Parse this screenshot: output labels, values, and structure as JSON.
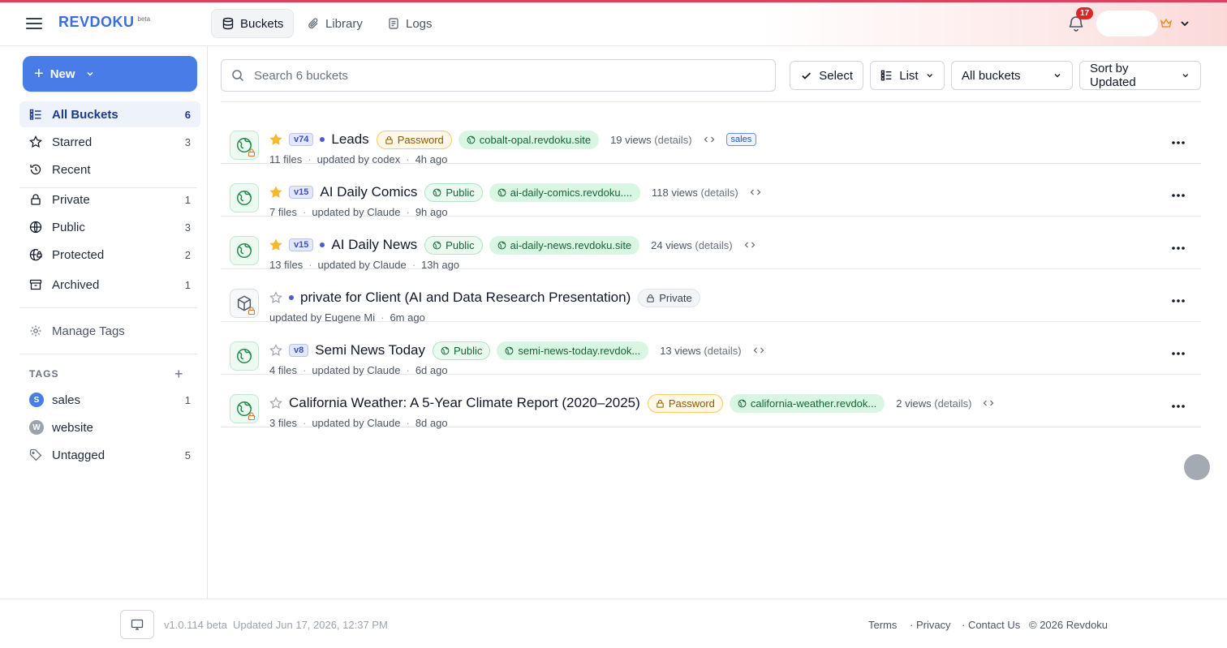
{
  "header": {
    "logo": "REVDOKU",
    "logo_badge": "beta",
    "tabs": [
      {
        "label": "Buckets",
        "icon": "database-icon",
        "active": true
      },
      {
        "label": "Library",
        "icon": "paperclip-icon"
      },
      {
        "label": "Logs",
        "icon": "logs-icon"
      }
    ],
    "notification_count": "17"
  },
  "sidebar": {
    "new_label": "New",
    "items": [
      {
        "label": "All Buckets",
        "count": "6"
      },
      {
        "label": "Starred",
        "count": "3"
      },
      {
        "label": "Recent"
      },
      {
        "label": "Private",
        "count": "1"
      },
      {
        "label": "Public",
        "count": "3"
      },
      {
        "label": "Protected",
        "count": "2"
      },
      {
        "label": "Archived",
        "count": "1"
      },
      {
        "label": "Manage Tags"
      }
    ],
    "tags_heading": "TAGS",
    "tags_add": "+",
    "tags": [
      {
        "letter": "S",
        "label": "sales",
        "count": "1",
        "color": "#4a7ce8"
      },
      {
        "letter": "W",
        "label": "website",
        "color": "#9ca3af"
      },
      {
        "label": "Untagged",
        "count": "5"
      }
    ]
  },
  "toolbar": {
    "search_placeholder": "Search 6 buckets",
    "select_label": "Select",
    "view_label": "List",
    "filter_label": "All buckets",
    "sort_label": "Sort by Updated"
  },
  "buckets": [
    {
      "version": "v74",
      "name": "Leads",
      "access": "Password",
      "domain": "cobalt-opal.revdoku.site",
      "views": "19 views",
      "details": "(details)",
      "tag": "sales",
      "files": "11 files",
      "updated_by": "updated by codex",
      "ago": "4h ago"
    },
    {
      "version": "v15",
      "name": "AI Daily Comics",
      "access": "Public",
      "domain": "ai-daily-comics.revdoku....",
      "views": "118 views",
      "details": "(details)",
      "files": "7 files",
      "updated_by": "updated by Claude",
      "ago": "9h ago"
    },
    {
      "version": "v15",
      "name": "AI Daily News",
      "access": "Public",
      "domain": "ai-daily-news.revdoku.site",
      "views": "24 views",
      "details": "(details)",
      "files": "13 files",
      "updated_by": "updated by Claude",
      "ago": "13h ago"
    },
    {
      "name": "private for Client (AI and Data Research Presentation)",
      "access": "Private",
      "updated_by": "updated by Eugene Mi",
      "ago": "6m ago"
    },
    {
      "version": "v8",
      "name": "Semi News Today",
      "access": "Public",
      "domain": "semi-news-today.revdok...",
      "views": "13 views",
      "details": "(details)",
      "files": "4 files",
      "updated_by": "updated by Claude",
      "ago": "6d ago"
    },
    {
      "name": "California Weather: A 5-Year Climate Report (2020–2025)",
      "access": "Password",
      "domain": "california-weather.revdok...",
      "views": "2 views",
      "details": "(details)",
      "files": "3 files",
      "updated_by": "updated by Claude",
      "ago": "8d ago"
    }
  ],
  "footer": {
    "version": "v1.0.114 beta",
    "updated": "Updated Jun 17, 2026, 12:37 PM",
    "links": [
      "Terms",
      "· Privacy",
      "· Contact Us"
    ],
    "copyright": "© 2026 Revdoku"
  },
  "colors": {
    "accent": "#4a7ce8",
    "brand": "#3b6fd8",
    "alert": "#dc2626",
    "star": "#f5b82e"
  }
}
